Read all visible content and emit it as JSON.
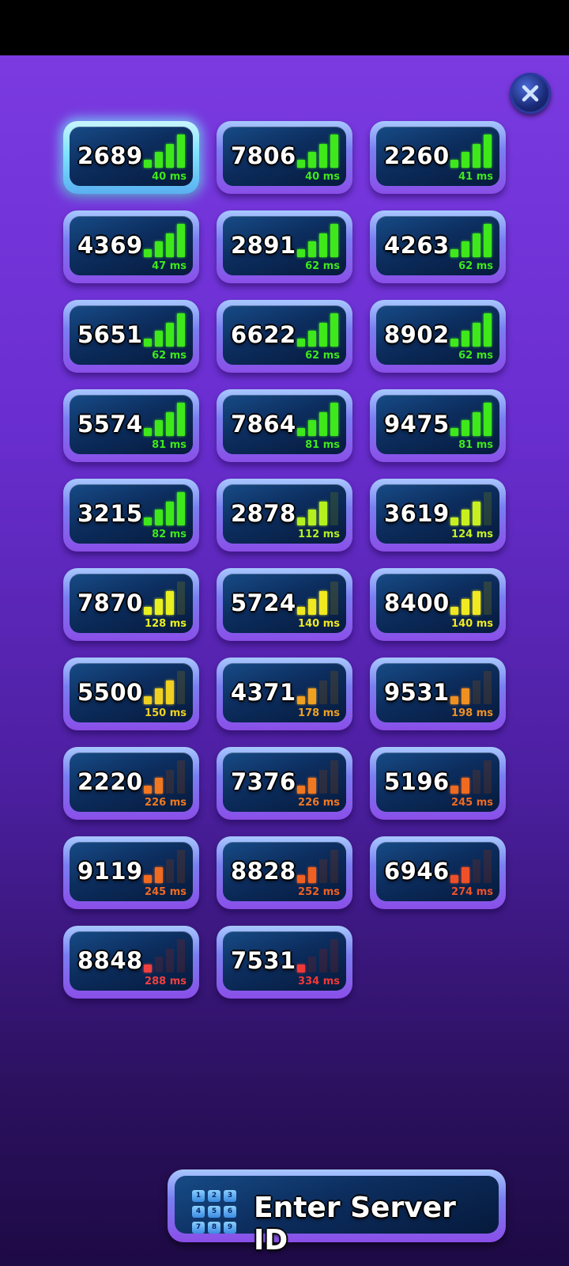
{
  "servers": [
    {
      "id": "2689",
      "ping": "40 ms",
      "bars": 4,
      "color": "#3ee81a",
      "selected": true
    },
    {
      "id": "7806",
      "ping": "40 ms",
      "bars": 4,
      "color": "#3ee81a"
    },
    {
      "id": "2260",
      "ping": "41 ms",
      "bars": 4,
      "color": "#3ee81a"
    },
    {
      "id": "4369",
      "ping": "47 ms",
      "bars": 4,
      "color": "#3ee81a"
    },
    {
      "id": "2891",
      "ping": "62 ms",
      "bars": 4,
      "color": "#3ee81a"
    },
    {
      "id": "4263",
      "ping": "62 ms",
      "bars": 4,
      "color": "#3ee81a"
    },
    {
      "id": "5651",
      "ping": "62 ms",
      "bars": 4,
      "color": "#3ee81a"
    },
    {
      "id": "6622",
      "ping": "62 ms",
      "bars": 4,
      "color": "#3ee81a"
    },
    {
      "id": "8902",
      "ping": "62 ms",
      "bars": 4,
      "color": "#3ee81a"
    },
    {
      "id": "5574",
      "ping": "81 ms",
      "bars": 4,
      "color": "#3ee81a"
    },
    {
      "id": "7864",
      "ping": "81 ms",
      "bars": 4,
      "color": "#3ee81a"
    },
    {
      "id": "9475",
      "ping": "81 ms",
      "bars": 4,
      "color": "#3ee81a"
    },
    {
      "id": "3215",
      "ping": "82 ms",
      "bars": 4,
      "color": "#3ee81a"
    },
    {
      "id": "2878",
      "ping": "112 ms",
      "bars": 3,
      "color": "#b4f020"
    },
    {
      "id": "3619",
      "ping": "124 ms",
      "bars": 3,
      "color": "#c8f020"
    },
    {
      "id": "7870",
      "ping": "128 ms",
      "bars": 3,
      "color": "#e8f020"
    },
    {
      "id": "5724",
      "ping": "140 ms",
      "bars": 3,
      "color": "#f0e820"
    },
    {
      "id": "8400",
      "ping": "140 ms",
      "bars": 3,
      "color": "#f0e820"
    },
    {
      "id": "5500",
      "ping": "150 ms",
      "bars": 3,
      "color": "#f0d020"
    },
    {
      "id": "4371",
      "ping": "178 ms",
      "bars": 2,
      "color": "#f0a020"
    },
    {
      "id": "9531",
      "ping": "198 ms",
      "bars": 2,
      "color": "#f09020"
    },
    {
      "id": "2220",
      "ping": "226 ms",
      "bars": 2,
      "color": "#f07820"
    },
    {
      "id": "7376",
      "ping": "226 ms",
      "bars": 2,
      "color": "#f07820"
    },
    {
      "id": "5196",
      "ping": "245 ms",
      "bars": 2,
      "color": "#f06a20"
    },
    {
      "id": "9119",
      "ping": "245 ms",
      "bars": 2,
      "color": "#f06a20"
    },
    {
      "id": "8828",
      "ping": "252 ms",
      "bars": 2,
      "color": "#f06020"
    },
    {
      "id": "6946",
      "ping": "274 ms",
      "bars": 2,
      "color": "#f05028"
    },
    {
      "id": "8848",
      "ping": "288 ms",
      "bars": 1,
      "color": "#f04040"
    },
    {
      "id": "7531",
      "ping": "334 ms",
      "bars": 1,
      "color": "#f03838"
    }
  ],
  "enter_button": {
    "label": "Enter Server ID",
    "keypad_digits": [
      "1",
      "2",
      "3",
      "4",
      "5",
      "6",
      "7",
      "8",
      "9"
    ]
  },
  "close_icon": "close-icon",
  "colors": {
    "unselected_frame": "#8a4ee8",
    "selected_frame": "#7ee2ff",
    "card_body": "#0c2d5e"
  }
}
